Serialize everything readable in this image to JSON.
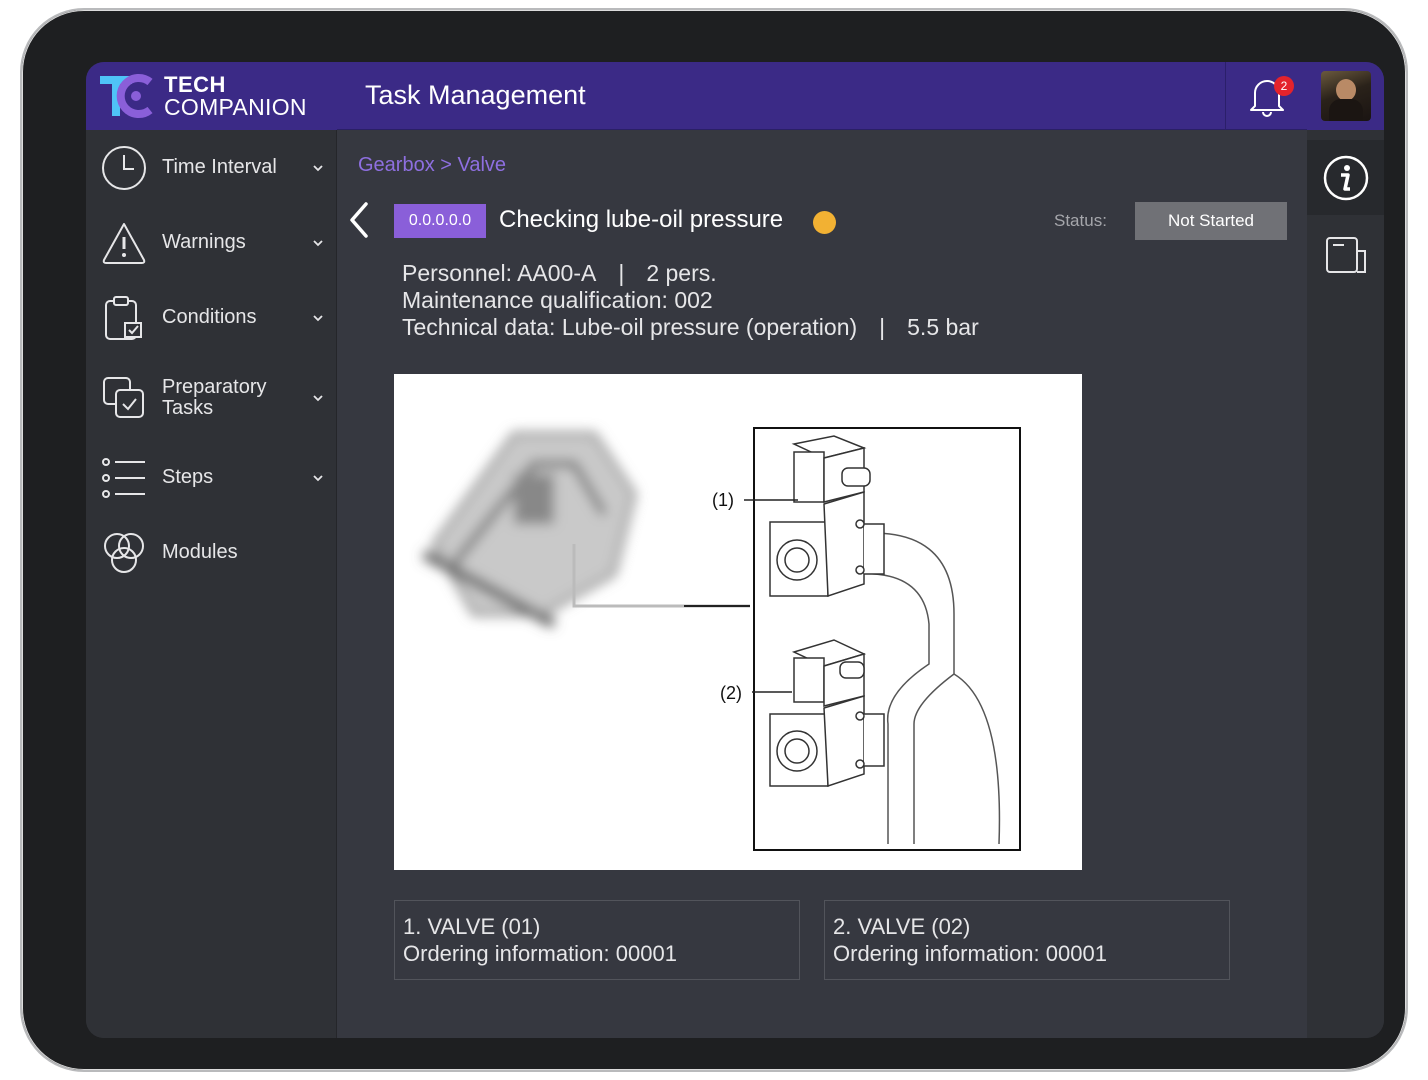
{
  "brand": {
    "line1": "TECH",
    "line2": "COMPANION"
  },
  "header": {
    "title": "Task Management",
    "notifications": "2"
  },
  "nav": [
    {
      "label": "Time Interval",
      "icon": "clock-icon"
    },
    {
      "label": "Warnings",
      "icon": "warning-icon"
    },
    {
      "label": "Conditions",
      "icon": "clipboard-check-icon"
    },
    {
      "label": "Preparatory Tasks",
      "line1": "Preparatory",
      "line2": "Tasks",
      "icon": "preparatory-tasks-icon"
    },
    {
      "label": "Steps",
      "icon": "list-icon"
    },
    {
      "label": "Modules",
      "icon": "modules-icon"
    }
  ],
  "breadcrumb": "Gearbox > Valve",
  "task": {
    "code": "0.0.0.0.0",
    "title": "Checking lube-oil pressure",
    "status_label": "Status:",
    "status": "Not Started",
    "status_color": "#f2b133"
  },
  "meta": {
    "personnel": "Personnel: AA00-A",
    "persons": "2 pers.",
    "qualification": "Maintenance qualification: 002",
    "technical": "Technical data: Lube-oil pressure (operation)",
    "value": "5.5 bar"
  },
  "figure": {
    "callout1": "(1)",
    "callout2": "(2)"
  },
  "parts": [
    {
      "name": "1. VALVE (01)",
      "ordering": "Ordering information: 00001"
    },
    {
      "name": "2. VALVE (02)",
      "ordering": "Ordering information: 00001"
    }
  ],
  "colors": {
    "header": "#3b2a86",
    "accent": "#8a5fd9",
    "badge": "#e4232c"
  }
}
